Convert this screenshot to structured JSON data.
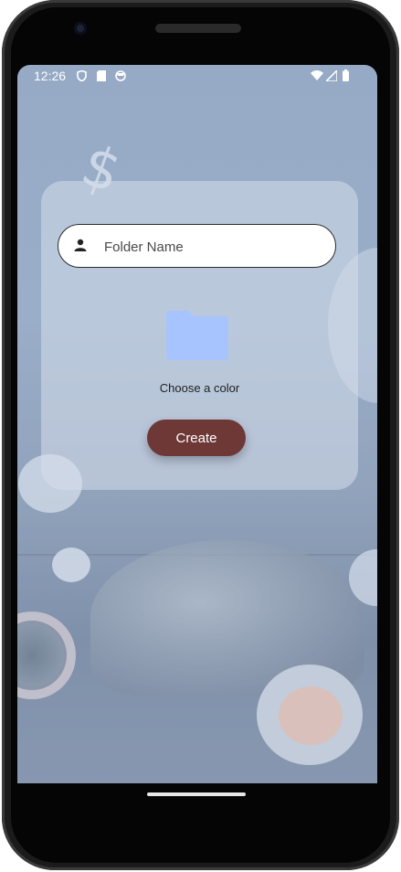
{
  "status_bar": {
    "time": "12:26"
  },
  "form": {
    "folder_name_placeholder": "Folder Name",
    "choose_color_label": "Choose a color",
    "create_label": "Create",
    "folder_color": "#a7c4ff"
  },
  "colors": {
    "create_button": "#6e3837"
  },
  "icons": {
    "status_left": [
      "shield-icon",
      "sd-card-icon",
      "smiley-icon"
    ],
    "status_right": [
      "wifi-icon",
      "signal-icon",
      "battery-icon"
    ],
    "field": "person-icon",
    "folder": "folder-icon"
  }
}
